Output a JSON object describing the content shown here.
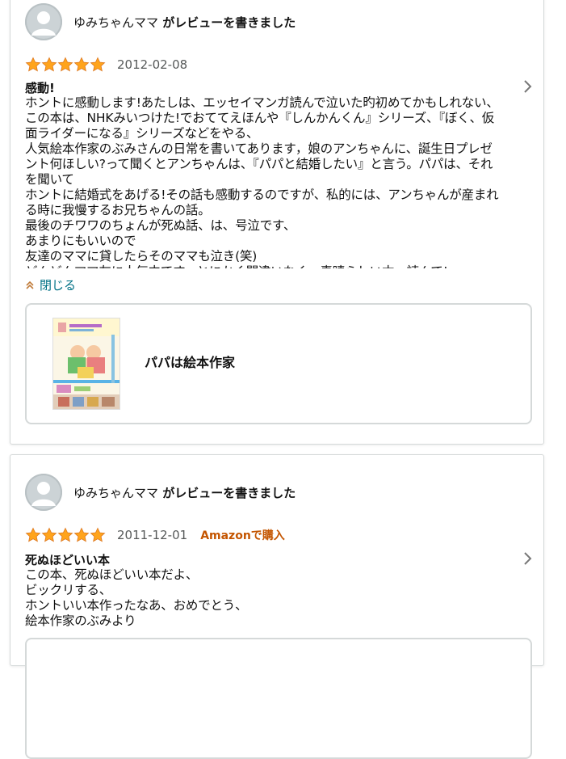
{
  "reviews": [
    {
      "author_name": "ゆみちゃんママ",
      "author_action": " がレビューを書きました",
      "rating": 5,
      "date": "2012-02-08",
      "badge": "",
      "title": "感動!",
      "body": "ホントに感動します!あたしは、エッセイマンガ読んで泣いた旳初めてかもしれない、\nこの本は、NHKみいつけた!でおててえほんや『しんかんくん』シリーズ、『ぼく、仮\n面ライダーになる』シリーズなどをやる、\n人気絵本作家のぶみさんの日常を書いてあります，娘のアンちゃんに、誕生日プレゼ\nント何ほしい?って聞くとアンちゃんは、『パパと結婚したい』と言う。パパは、それ\nを聞いて\nホントに結婚式をあげる!その話も感動するのですが、私的には、アンちゃんが産まれ\nる時に我慢するお兄ちゃんの話。\n最後のチワワのちょんが死ぬ話、は、号泣です、\nあまりにもいいので\n友達のママに貸したらそのママも泣き(笑)\nどんどんママ友に人気中です、とにかく間違いなく、素晴らしい本、読んで!",
      "collapse_label": "閉じる",
      "product_title": "パパは絵本作家"
    },
    {
      "author_name": "ゆみちゃんママ",
      "author_action": " がレビューを書きました",
      "rating": 5,
      "date": "2011-12-01",
      "badge": "Amazonで購入",
      "title": "死ぬほどいい本",
      "body": "この本、死ぬほどいい本だよ、\nビックリする、\nホントいい本作ったなあ、おめでとう、\n絵本作家のぶみより"
    }
  ],
  "colors": {
    "star": "#ffa41c",
    "link": "#007185",
    "badge": "#c45500"
  },
  "icons": {
    "star": "star-icon",
    "chevron": "chevron-right-icon",
    "collapse": "chevron-up-double-icon",
    "avatar": "user-avatar-icon"
  }
}
